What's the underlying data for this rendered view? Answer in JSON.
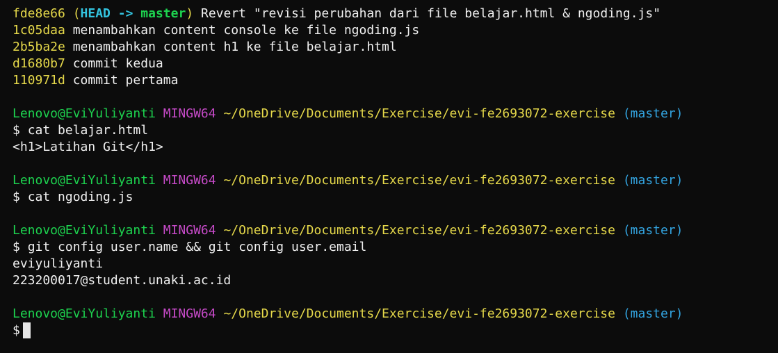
{
  "log": {
    "first": {
      "hash": "fde8e66",
      "head_open": "(",
      "head": "HEAD",
      "arrow": "->",
      "branch": "master",
      "head_close": ")",
      "message": "Revert \"revisi perubahan dari file belajar.html & ngoding.js\""
    },
    "entries": [
      {
        "hash": "1c05daa",
        "message": "menambahkan content console ke file ngoding.js"
      },
      {
        "hash": "2b5ba2e",
        "message": "menambahkan content h1 ke file belajar.html"
      },
      {
        "hash": "d1680b7",
        "message": "commit kedua"
      },
      {
        "hash": "110971d",
        "message": "commit pertama"
      }
    ]
  },
  "prompt": {
    "user_host": "Lenovo@EviYuliyanti",
    "system": "MINGW64",
    "path": "~/OneDrive/Documents/Exercise/evi-fe2693072-exercise",
    "branch": "(master)",
    "symbol": "$"
  },
  "blocks": {
    "b1": {
      "command": "cat belajar.html",
      "output": [
        "<h1>Latihan Git</h1>"
      ]
    },
    "b2": {
      "command": "cat ngoding.js"
    },
    "b3": {
      "command": "git config user.name && git config user.email",
      "output": [
        "eviyuliyanti",
        "223200017@student.unaki.ac.id"
      ]
    }
  },
  "colors": {
    "background": "#0c0c0c",
    "hash": "#e5d84a",
    "user_host": "#1dd34f",
    "system": "#c64ac8",
    "path": "#e5d84a",
    "branch": "#33a4e0",
    "text": "#f0f0f0"
  }
}
